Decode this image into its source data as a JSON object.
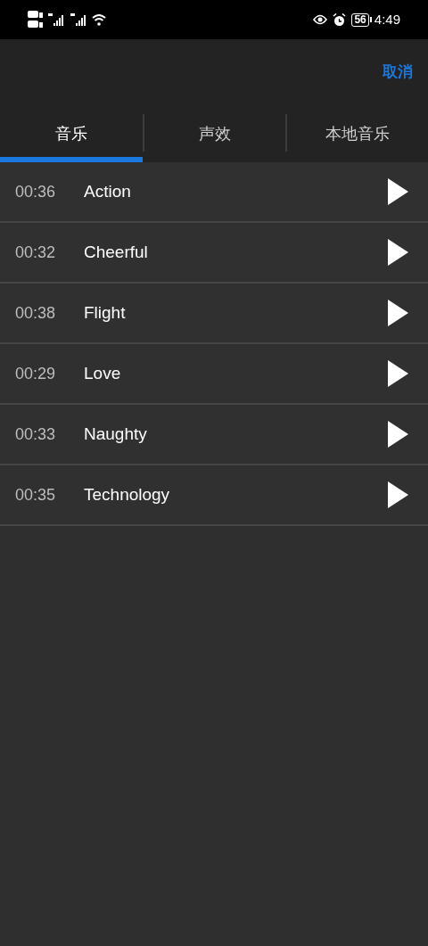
{
  "status_bar": {
    "battery": "56",
    "time": "4:49"
  },
  "header": {
    "cancel": "取消"
  },
  "tabs": [
    {
      "label": "音乐",
      "selected": true
    },
    {
      "label": "声效",
      "selected": false
    },
    {
      "label": "本地音乐",
      "selected": false
    }
  ],
  "tracks": [
    {
      "duration": "00:36",
      "title": "Action"
    },
    {
      "duration": "00:32",
      "title": "Cheerful"
    },
    {
      "duration": "00:38",
      "title": "Flight"
    },
    {
      "duration": "00:29",
      "title": "Love"
    },
    {
      "duration": "00:33",
      "title": "Naughty"
    },
    {
      "duration": "00:35",
      "title": "Technology"
    }
  ]
}
